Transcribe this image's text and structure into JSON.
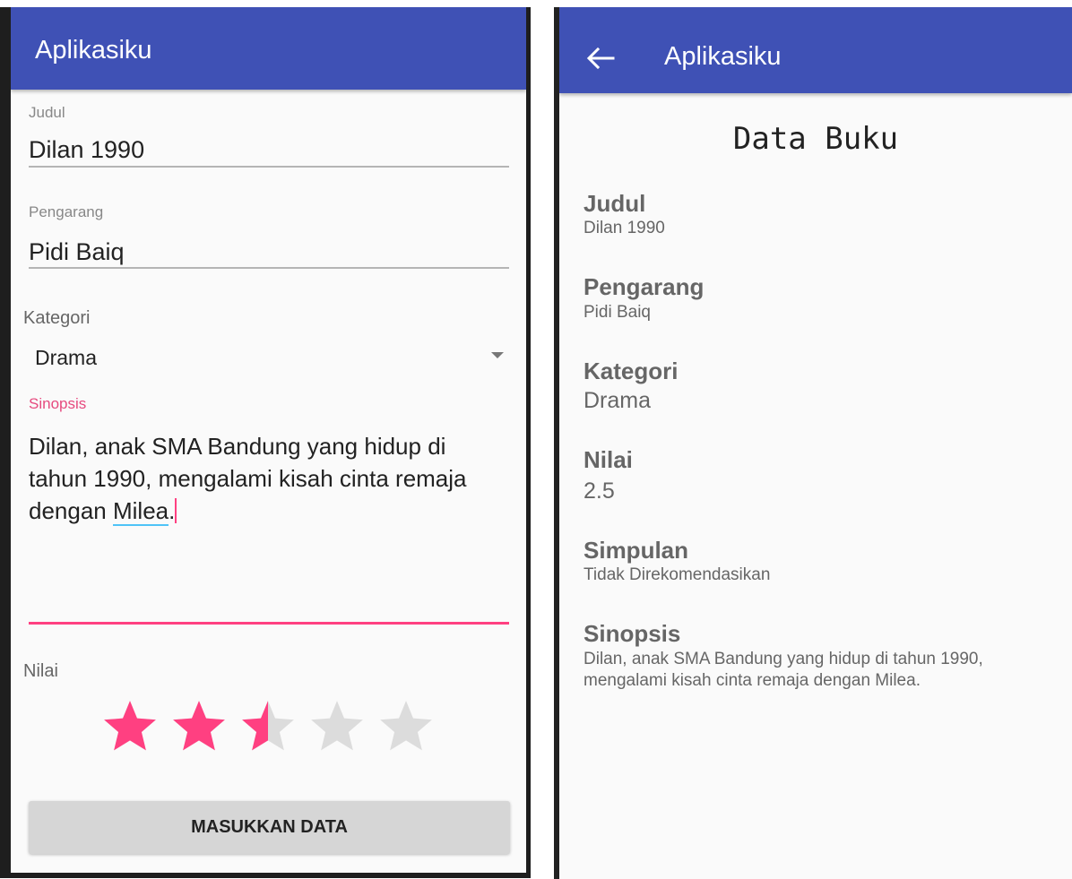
{
  "form_screen": {
    "app_title": "Aplikasiku",
    "judul": {
      "label": "Judul",
      "value": "Dilan 1990"
    },
    "pengarang": {
      "label": "Pengarang",
      "value": "Pidi Baiq"
    },
    "kategori": {
      "label": "Kategori",
      "selected": "Drama"
    },
    "sinopsis": {
      "label": "Sinopsis",
      "value_before": "Dilan, anak SMA Bandung yang hidup di tahun 1990, mengalami kisah cinta remaja dengan ",
      "value_underlined": "Milea",
      "value_after": "."
    },
    "nilai": {
      "label": "Nilai",
      "rating": 2.5,
      "max": 5
    },
    "submit_label": "MASUKKAN DATA"
  },
  "detail_screen": {
    "app_title": "Aplikasiku",
    "heading": "Data Buku",
    "fields": {
      "judul": {
        "label": "Judul",
        "value": "Dilan 1990"
      },
      "pengarang": {
        "label": "Pengarang",
        "value": "Pidi Baiq"
      },
      "kategori": {
        "label": "Kategori",
        "value": "Drama"
      },
      "nilai": {
        "label": "Nilai",
        "value": "2.5"
      },
      "simpulan": {
        "label": "Simpulan",
        "value": "Tidak Direkomendasikan"
      },
      "sinopsis": {
        "label": "Sinopsis",
        "value": "Dilan, anak SMA Bandung yang hidup di tahun 1990, mengalami kisah cinta remaja dengan Milea."
      }
    }
  },
  "colors": {
    "app_bar": "#3f51b5",
    "accent": "#ff4081",
    "star_filled": "#ff4081",
    "star_empty": "#dcdcdc",
    "background": "#fafafa"
  },
  "icons": {
    "back": "arrow-left-icon",
    "dropdown": "caret-down-icon",
    "star": "star-icon"
  }
}
